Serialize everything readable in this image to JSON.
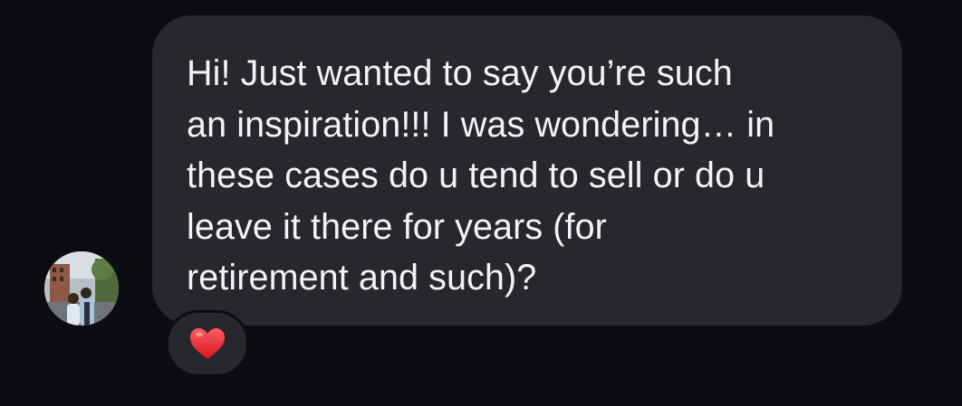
{
  "message": {
    "text": "Hi! Just wanted to say you’re such\nan inspiration!!! I was wondering… in\nthese cases do u tend to sell or do u\nleave it there for years (for\nretirement and such)?",
    "reaction_icon": "red-heart-icon"
  },
  "colors": {
    "background": "#0b0d12",
    "bubble": "#26282d",
    "text": "#f2f3f5",
    "heart": "#e0242c"
  }
}
